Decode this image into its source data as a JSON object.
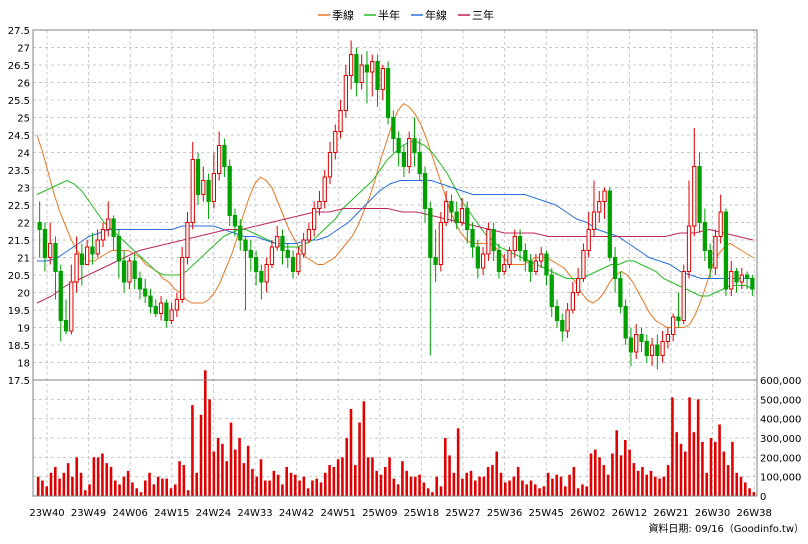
{
  "chart_data": {
    "type": "candlestick",
    "legend": [
      {
        "name": "季線",
        "color": "#e87722"
      },
      {
        "name": "半年",
        "color": "#22bb22"
      },
      {
        "name": "年線",
        "color": "#2a6fdb"
      },
      {
        "name": "三年",
        "color": "#c0245c"
      }
    ],
    "price_axis": {
      "ylim": [
        17.5,
        27.5
      ],
      "ticks": [
        "27.5",
        "27",
        "26.5",
        "26",
        "25.5",
        "25",
        "24.5",
        "24",
        "23.5",
        "23",
        "22.5",
        "22",
        "21.5",
        "21",
        "20.5",
        "20",
        "19.5",
        "19",
        "18.5",
        "18",
        "17.5"
      ]
    },
    "volume_axis": {
      "ylim": [
        0,
        600000
      ],
      "ticks": [
        "600,000",
        "500,000",
        "400,000",
        "300,000",
        "200,000",
        "100,000",
        "0"
      ]
    },
    "x_labels": [
      "23W40",
      "23W49",
      "24W06",
      "24W15",
      "24W24",
      "24W33",
      "24W42",
      "24W51",
      "25W09",
      "25W18",
      "25W27",
      "25W36",
      "25W45",
      "26W02",
      "26W12",
      "26W21",
      "26W30",
      "26W38"
    ],
    "candles": [
      [
        22.0,
        21.8,
        22.6,
        21.0
      ],
      [
        21.8,
        21.0,
        22.0,
        20.6
      ],
      [
        21.0,
        21.4,
        22.0,
        20.8
      ],
      [
        21.4,
        20.6,
        21.6,
        19.8
      ],
      [
        20.6,
        19.2,
        20.8,
        18.6
      ],
      [
        19.2,
        18.9,
        19.8,
        18.8
      ],
      [
        18.9,
        20.3,
        20.8,
        18.8
      ],
      [
        20.3,
        21.1,
        21.6,
        20.0
      ],
      [
        21.1,
        20.8,
        21.4,
        20.2
      ],
      [
        20.8,
        21.3,
        21.5,
        20.8
      ],
      [
        21.3,
        21.1,
        21.7,
        20.8
      ],
      [
        21.1,
        21.5,
        21.8,
        21.0
      ],
      [
        21.5,
        21.8,
        22.0,
        21.3
      ],
      [
        21.8,
        22.1,
        22.6,
        21.6
      ],
      [
        22.1,
        21.6,
        22.2,
        21.2
      ],
      [
        21.6,
        20.9,
        21.8,
        20.4
      ],
      [
        20.9,
        20.3,
        21.2,
        20.0
      ],
      [
        20.3,
        20.9,
        21.0,
        20.1
      ],
      [
        20.9,
        20.4,
        21.1,
        20.1
      ],
      [
        20.4,
        20.1,
        20.6,
        19.8
      ],
      [
        20.1,
        19.9,
        20.4,
        19.7
      ],
      [
        19.9,
        19.6,
        20.1,
        19.4
      ],
      [
        19.6,
        19.4,
        19.8,
        19.3
      ],
      [
        19.4,
        19.7,
        19.9,
        19.2
      ],
      [
        19.7,
        19.2,
        19.8,
        19.0
      ],
      [
        19.2,
        19.5,
        19.7,
        19.1
      ],
      [
        19.5,
        19.8,
        20.0,
        19.3
      ],
      [
        19.8,
        21.0,
        21.3,
        19.7
      ],
      [
        21.0,
        22.0,
        22.3,
        20.8
      ],
      [
        22.0,
        23.8,
        24.3,
        21.8
      ],
      [
        23.8,
        22.8,
        24.0,
        22.5
      ],
      [
        22.8,
        23.2,
        23.6,
        22.6
      ],
      [
        23.2,
        22.6,
        23.4,
        22.1
      ],
      [
        22.6,
        23.4,
        24.0,
        22.4
      ],
      [
        23.4,
        24.2,
        24.6,
        23.2
      ],
      [
        24.2,
        23.6,
        24.4,
        23.3
      ],
      [
        23.6,
        22.2,
        23.8,
        21.9
      ],
      [
        22.2,
        21.9,
        22.4,
        21.6
      ],
      [
        21.9,
        21.5,
        22.1,
        21.2
      ],
      [
        21.5,
        21.2,
        21.6,
        19.5
      ],
      [
        21.2,
        21.0,
        21.5,
        20.6
      ],
      [
        21.0,
        20.6,
        21.2,
        20.2
      ],
      [
        20.6,
        20.3,
        20.8,
        19.8
      ],
      [
        20.3,
        20.8,
        21.0,
        20.0
      ],
      [
        20.8,
        21.3,
        21.5,
        20.7
      ],
      [
        21.3,
        21.6,
        21.9,
        21.2
      ],
      [
        21.6,
        21.2,
        21.8,
        20.8
      ],
      [
        21.2,
        21.0,
        21.4,
        20.7
      ],
      [
        21.0,
        20.6,
        21.2,
        20.4
      ],
      [
        20.6,
        21.1,
        21.3,
        20.5
      ],
      [
        21.1,
        21.5,
        21.7,
        21.0
      ],
      [
        21.5,
        21.8,
        22.0,
        21.4
      ],
      [
        21.8,
        22.4,
        22.6,
        21.6
      ],
      [
        22.4,
        22.6,
        22.9,
        22.2
      ],
      [
        22.6,
        23.3,
        23.5,
        22.4
      ],
      [
        23.3,
        24.0,
        24.3,
        23.1
      ],
      [
        24.0,
        24.6,
        24.8,
        23.8
      ],
      [
        24.6,
        25.2,
        25.5,
        24.4
      ],
      [
        25.2,
        26.2,
        26.5,
        25.0
      ],
      [
        26.2,
        26.8,
        27.2,
        25.8
      ],
      [
        26.8,
        26.0,
        27.0,
        25.6
      ],
      [
        26.0,
        26.5,
        26.8,
        25.8
      ],
      [
        26.5,
        26.3,
        26.9,
        25.4
      ],
      [
        26.3,
        26.6,
        26.8,
        25.6
      ],
      [
        26.6,
        25.8,
        26.8,
        25.3
      ],
      [
        25.8,
        26.4,
        26.5,
        25.5
      ],
      [
        26.4,
        25.0,
        26.6,
        24.8
      ],
      [
        25.0,
        24.4,
        25.2,
        24.0
      ],
      [
        24.4,
        24.0,
        24.6,
        23.6
      ],
      [
        24.0,
        23.6,
        24.2,
        23.3
      ],
      [
        23.6,
        24.4,
        24.6,
        23.4
      ],
      [
        24.4,
        24.0,
        25.0,
        23.6
      ],
      [
        24.0,
        23.4,
        24.4,
        23.2
      ],
      [
        23.4,
        22.4,
        23.6,
        22.0
      ],
      [
        22.4,
        21.0,
        22.6,
        18.2
      ],
      [
        21.0,
        20.8,
        21.8,
        20.3
      ],
      [
        20.8,
        22.0,
        22.3,
        20.6
      ],
      [
        22.0,
        22.6,
        22.9,
        21.9
      ],
      [
        22.6,
        22.3,
        22.8,
        22.0
      ],
      [
        22.3,
        22.0,
        22.6,
        21.8
      ],
      [
        22.0,
        22.4,
        22.7,
        21.9
      ],
      [
        22.4,
        21.8,
        22.6,
        21.4
      ],
      [
        21.8,
        21.3,
        22.0,
        21.0
      ],
      [
        21.3,
        20.7,
        21.5,
        20.4
      ],
      [
        20.7,
        21.1,
        21.3,
        20.5
      ],
      [
        21.1,
        21.8,
        22.0,
        20.9
      ],
      [
        21.8,
        21.2,
        22.0,
        20.9
      ],
      [
        21.2,
        20.6,
        21.4,
        20.4
      ],
      [
        20.6,
        20.8,
        21.1,
        20.5
      ],
      [
        20.8,
        21.2,
        21.3,
        20.7
      ],
      [
        21.2,
        21.6,
        21.8,
        21.0
      ],
      [
        21.6,
        21.2,
        21.8,
        20.9
      ],
      [
        21.2,
        20.9,
        21.4,
        20.6
      ],
      [
        20.9,
        20.6,
        21.1,
        20.3
      ],
      [
        20.6,
        20.9,
        21.1,
        20.5
      ],
      [
        20.9,
        21.1,
        21.3,
        20.7
      ],
      [
        21.1,
        20.5,
        21.2,
        20.2
      ],
      [
        20.5,
        19.6,
        20.7,
        19.3
      ],
      [
        19.6,
        19.2,
        19.8,
        19.0
      ],
      [
        19.2,
        18.9,
        19.4,
        18.6
      ],
      [
        18.9,
        19.5,
        19.7,
        18.7
      ],
      [
        19.5,
        20.0,
        20.3,
        19.4
      ],
      [
        20.0,
        20.4,
        20.7,
        19.9
      ],
      [
        20.4,
        21.2,
        21.4,
        20.3
      ],
      [
        21.2,
        21.8,
        22.3,
        21.0
      ],
      [
        21.8,
        22.3,
        23.2,
        21.6
      ],
      [
        22.3,
        22.6,
        22.9,
        22.0
      ],
      [
        22.6,
        22.9,
        23.0,
        22.1
      ],
      [
        22.9,
        21.0,
        23.0,
        20.9
      ],
      [
        21.0,
        20.4,
        21.3,
        20.0
      ],
      [
        20.4,
        19.6,
        20.6,
        19.4
      ],
      [
        19.6,
        18.7,
        19.8,
        18.5
      ],
      [
        18.7,
        18.3,
        19.0,
        17.9
      ],
      [
        18.3,
        18.8,
        19.1,
        18.1
      ],
      [
        18.8,
        18.6,
        19.0,
        18.3
      ],
      [
        18.6,
        18.2,
        18.8,
        18.0
      ],
      [
        18.2,
        18.5,
        18.7,
        17.9
      ],
      [
        18.5,
        18.2,
        18.8,
        17.8
      ],
      [
        18.2,
        18.6,
        18.9,
        18.0
      ],
      [
        18.6,
        18.8,
        19.0,
        18.4
      ],
      [
        18.8,
        19.3,
        19.4,
        18.6
      ],
      [
        19.3,
        19.2,
        20.0,
        19.0
      ],
      [
        19.2,
        20.6,
        20.8,
        19.1
      ],
      [
        20.6,
        21.9,
        23.2,
        20.4
      ],
      [
        21.9,
        23.6,
        24.7,
        21.6
      ],
      [
        23.6,
        22.0,
        24.0,
        21.7
      ],
      [
        22.0,
        21.2,
        22.4,
        20.9
      ],
      [
        21.2,
        20.7,
        21.4,
        20.4
      ],
      [
        20.7,
        21.6,
        21.8,
        20.5
      ],
      [
        21.6,
        22.3,
        22.8,
        21.4
      ],
      [
        22.3,
        20.1,
        22.4,
        19.9
      ],
      [
        20.1,
        20.6,
        20.9,
        19.9
      ],
      [
        20.6,
        20.3,
        20.7,
        20.0
      ],
      [
        20.3,
        20.5,
        20.7,
        20.1
      ],
      [
        20.5,
        20.4,
        20.6,
        20.1
      ],
      [
        20.4,
        20.1,
        20.5,
        19.9
      ]
    ],
    "volume": [
      100000,
      80000,
      50000,
      120000,
      150000,
      90000,
      120000,
      170000,
      100000,
      200000,
      120000,
      30000,
      60000,
      200000,
      200000,
      220000,
      170000,
      150000,
      80000,
      60000,
      100000,
      130000,
      70000,
      40000,
      20000,
      80000,
      120000,
      60000,
      100000,
      90000,
      90000,
      40000,
      60000,
      180000,
      160000,
      30000,
      470000,
      120000,
      420000,
      650000,
      500000,
      230000,
      300000,
      270000,
      180000,
      380000,
      240000,
      300000,
      170000,
      260000,
      140000,
      100000,
      190000,
      80000,
      80000,
      130000,
      110000,
      60000,
      150000,
      120000,
      110000,
      80000,
      100000,
      40000,
      80000,
      90000,
      70000,
      120000,
      160000,
      150000,
      190000,
      200000,
      300000,
      450000,
      160000,
      380000,
      490000,
      200000,
      200000,
      130000,
      110000,
      150000,
      200000,
      90000,
      60000,
      180000,
      130000,
      100000,
      100000,
      110000,
      70000,
      40000,
      20000,
      100000,
      50000,
      300000,
      210000,
      120000,
      350000,
      90000,
      120000,
      130000,
      80000,
      100000,
      100000,
      150000,
      160000,
      230000,
      120000,
      70000,
      80000,
      100000,
      150000,
      80000,
      60000,
      80000,
      60000,
      40000,
      50000,
      120000,
      90000,
      110000,
      100000,
      50000,
      110000,
      150000,
      40000,
      60000,
      50000,
      220000,
      240000,
      200000,
      160000,
      110000,
      220000,
      340000,
      210000,
      290000,
      240000,
      170000,
      130000,
      150000,
      110000,
      130000,
      100000,
      90000,
      100000,
      160000,
      510000,
      330000,
      270000,
      230000,
      510000,
      330000,
      500000,
      280000,
      120000,
      300000,
      280000,
      370000,
      230000,
      160000,
      280000,
      120000,
      100000,
      70000,
      40000,
      20000
    ],
    "ma_quarter": [
      24.5,
      24.0,
      23.4,
      22.8,
      22.3,
      21.9,
      21.5,
      21.2,
      21.0,
      20.9,
      20.9,
      21.0,
      21.1,
      21.2,
      21.2,
      21.2,
      21.2,
      21.1,
      21.0,
      20.8,
      20.7,
      20.6,
      20.4,
      20.3,
      20.1,
      20.0,
      19.8,
      19.7,
      19.7,
      19.7,
      19.8,
      20.0,
      20.3,
      20.7,
      21.1,
      21.6,
      22.2,
      22.7,
      23.1,
      23.3,
      23.2,
      23.0,
      22.6,
      22.2,
      21.8,
      21.5,
      21.2,
      21.0,
      20.9,
      20.8,
      20.8,
      20.9,
      21.0,
      21.2,
      21.4,
      21.6,
      21.9,
      22.3,
      22.7,
      23.2,
      23.8,
      24.3,
      24.8,
      25.2,
      25.4,
      25.3,
      25.1,
      24.8,
      24.4,
      23.9,
      23.4,
      22.9,
      22.4,
      22.0,
      21.7,
      21.5,
      21.4,
      21.4,
      21.4,
      21.4,
      21.3,
      21.1,
      20.9,
      20.8,
      20.8,
      20.8,
      20.9,
      21.0,
      21.0,
      21.0,
      20.9,
      20.8,
      20.7,
      20.5,
      20.3,
      20.0,
      19.8,
      19.7,
      19.8,
      20.0,
      20.3,
      20.5,
      20.6,
      20.5,
      20.3,
      20.0,
      19.7,
      19.4,
      19.2,
      19.1,
      19.0,
      19.0,
      19.0,
      19.0,
      19.1,
      19.4,
      19.8,
      20.3,
      20.8,
      21.1,
      21.3,
      21.4,
      21.3,
      21.2,
      21.1,
      21.0
    ],
    "ma_half": [
      22.8,
      22.9,
      23.0,
      23.1,
      23.2,
      23.1,
      22.9,
      22.6,
      22.3,
      22.0,
      21.8,
      21.6,
      21.4,
      21.2,
      21.0,
      20.8,
      20.6,
      20.5,
      20.5,
      20.5,
      20.6,
      20.8,
      21.0,
      21.2,
      21.4,
      21.6,
      21.7,
      21.8,
      21.8,
      21.7,
      21.6,
      21.5,
      21.4,
      21.3,
      21.3,
      21.3,
      21.4,
      21.5,
      21.7,
      21.9,
      22.1,
      22.4,
      22.6,
      22.8,
      23.0,
      23.2,
      23.5,
      23.8,
      24.0,
      24.2,
      24.3,
      24.3,
      24.2,
      24.0,
      23.7,
      23.4,
      23.0,
      22.6,
      22.3,
      22.0,
      21.7,
      21.5,
      21.3,
      21.2,
      21.1,
      21.0,
      20.9,
      20.8,
      20.7,
      20.6,
      20.5,
      20.4,
      20.4,
      20.4,
      20.5,
      20.6,
      20.7,
      20.8,
      20.8,
      20.9,
      20.9,
      20.8,
      20.7,
      20.6,
      20.4,
      20.3,
      20.2,
      20.1,
      20.0,
      19.9,
      19.9,
      20.0,
      20.1,
      20.2,
      20.2,
      20.2,
      20.1
    ],
    "ma_year": [
      20.9,
      20.9,
      21.0,
      21.2,
      21.4,
      21.6,
      21.7,
      21.8,
      21.8,
      21.8,
      21.8,
      21.8,
      21.8,
      21.8,
      21.9,
      21.9,
      21.9,
      21.9,
      21.8,
      21.7,
      21.6,
      21.6,
      21.5,
      21.4,
      21.4,
      21.4,
      21.5,
      21.5,
      21.6,
      21.8,
      22.0,
      22.3,
      22.6,
      22.9,
      23.1,
      23.2,
      23.2,
      23.2,
      23.2,
      23.1,
      23.0,
      22.9,
      22.8,
      22.8,
      22.8,
      22.8,
      22.8,
      22.8,
      22.7,
      22.6,
      22.5,
      22.3,
      22.1,
      22.0,
      21.8,
      21.7,
      21.6,
      21.4,
      21.2,
      21.0,
      20.9,
      20.8,
      20.6,
      20.5,
      20.4,
      20.4,
      20.4,
      20.4,
      20.4,
      20.4
    ],
    "ma_3year": [
      19.7,
      19.9,
      20.2,
      20.4,
      20.6,
      20.8,
      21.0,
      21.2,
      21.3,
      21.4,
      21.5,
      21.6,
      21.7,
      21.8,
      21.8,
      21.9,
      22.0,
      22.1,
      22.2,
      22.3,
      22.3,
      22.4,
      22.4,
      22.4,
      22.4,
      22.3,
      22.3,
      22.2,
      22.1,
      22.0,
      21.9,
      21.8,
      21.7,
      21.7,
      21.7,
      21.6,
      21.6,
      21.6,
      21.6,
      21.6,
      21.6,
      21.6,
      21.6,
      21.6,
      21.7,
      21.7,
      21.8,
      21.7,
      21.6,
      21.5
    ]
  },
  "footer": {
    "credit": "資料日期: 09/16（Goodinfo.tw）"
  }
}
